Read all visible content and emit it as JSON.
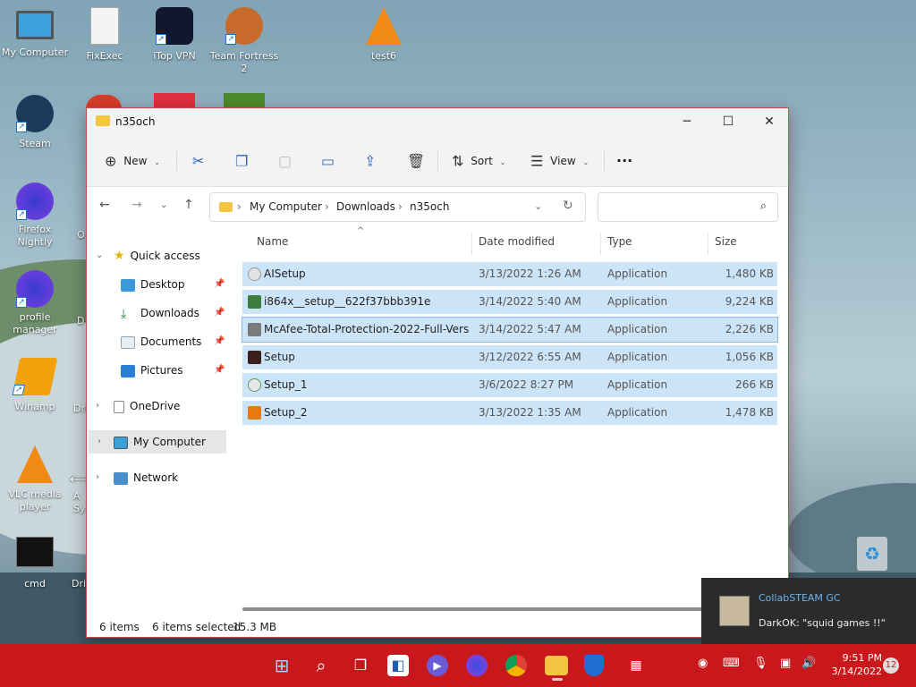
{
  "desktop": {
    "icons": [
      {
        "label": "My Computer"
      },
      {
        "label": "FixExec"
      },
      {
        "label": "iTop VPN"
      },
      {
        "label": "Team Fortress 2"
      },
      {
        "label": "test6"
      },
      {
        "label": "Steam"
      },
      {
        "label": "Firefox Nightly"
      },
      {
        "label": "profile manager"
      },
      {
        "label": "Winamp"
      },
      {
        "label": "VLC media player"
      },
      {
        "label": "cmd"
      }
    ]
  },
  "window": {
    "title": "n35och",
    "controls": {
      "minimize": "─",
      "maximize": "☐",
      "close": "✕"
    },
    "toolbar": {
      "new_label": "New",
      "sort_label": "Sort",
      "view_label": "View",
      "more_label": "···"
    },
    "breadcrumb": [
      "My Computer",
      "Downloads",
      "n35och"
    ],
    "nav_pane": {
      "quick_access": "Quick access",
      "items": [
        "Desktop",
        "Downloads",
        "Documents",
        "Pictures"
      ],
      "onedrive": "OneDrive",
      "my_computer": "My Computer",
      "network": "Network"
    },
    "columns": {
      "name": "Name",
      "date": "Date modified",
      "type": "Type",
      "size": "Size"
    },
    "files": [
      {
        "name": "AISetup",
        "date": "3/13/2022 1:26 AM",
        "type": "Application",
        "size": "1,480 KB"
      },
      {
        "name": "i864x__setup__622f37bbb391e",
        "date": "3/14/2022 5:40 AM",
        "type": "Application",
        "size": "9,224 KB"
      },
      {
        "name": "McAfee-Total-Protection-2022-Full-Versi...",
        "date": "3/14/2022 5:47 AM",
        "type": "Application",
        "size": "2,226 KB"
      },
      {
        "name": "Setup",
        "date": "3/12/2022 6:55 AM",
        "type": "Application",
        "size": "1,056 KB"
      },
      {
        "name": "Setup_1",
        "date": "3/6/2022 8:27 PM",
        "type": "Application",
        "size": "266 KB"
      },
      {
        "name": "Setup_2",
        "date": "3/13/2022 1:35 AM",
        "type": "Application",
        "size": "1,478 KB"
      }
    ],
    "status": {
      "items": "6 items",
      "selected": "6 items selected",
      "size": "15.3 MB"
    }
  },
  "notification": {
    "title": "CollabSTEAM GC",
    "message": "DarkOK: \"squid games !!\""
  },
  "taskbar": {
    "time": "9:51 PM",
    "date": "3/14/2022",
    "badge": "12"
  },
  "colors": {
    "taskbar": "#c8181b",
    "selection": "#cce4f7",
    "accent": "#2a64b5"
  }
}
